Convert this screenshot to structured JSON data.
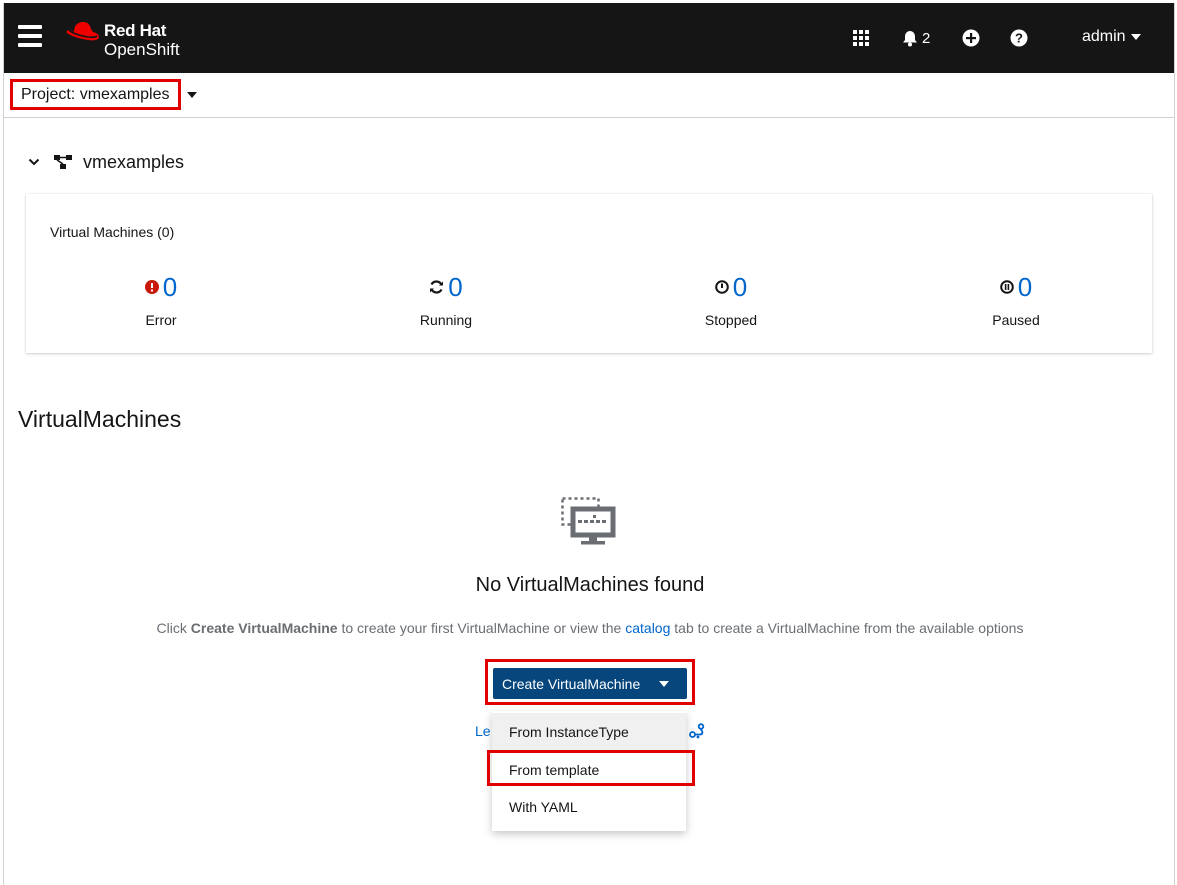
{
  "masthead": {
    "brand_line1": "Red Hat",
    "brand_line2": "OpenShift",
    "notification_count": "2",
    "user": "admin"
  },
  "project_bar": {
    "label": "Project: vmexamples"
  },
  "namespace": {
    "name": "vmexamples"
  },
  "status_card": {
    "title": "Virtual Machines (0)",
    "stats": [
      {
        "label": "Error",
        "value": "0",
        "icon": "error-circle-icon",
        "color": "#c9190b"
      },
      {
        "label": "Running",
        "value": "0",
        "icon": "sync-icon",
        "color": "#151515"
      },
      {
        "label": "Stopped",
        "value": "0",
        "icon": "stopped-icon",
        "color": "#151515"
      },
      {
        "label": "Paused",
        "value": "0",
        "icon": "paused-icon",
        "color": "#151515"
      }
    ]
  },
  "section": {
    "title": "VirtualMachines"
  },
  "empty_state": {
    "icon": "virtual-machine-icon",
    "title": "No VirtualMachines found",
    "body_click": "Click ",
    "body_bold": "Create VirtualMachine",
    "body_mid": " to create your first VirtualMachine or view the ",
    "body_link": "catalog",
    "body_end": " tab to create a VirtualMachine from the available options",
    "create_button": "Create VirtualMachine",
    "learn_link": "Le"
  },
  "create_menu": {
    "items": [
      "From InstanceType",
      "From template",
      "With YAML"
    ]
  },
  "colors": {
    "masthead_bg": "#151515",
    "primary_button": "#06467c",
    "link": "#0066cc",
    "highlight_box": "#e00000",
    "brand_red": "#ee0000"
  }
}
